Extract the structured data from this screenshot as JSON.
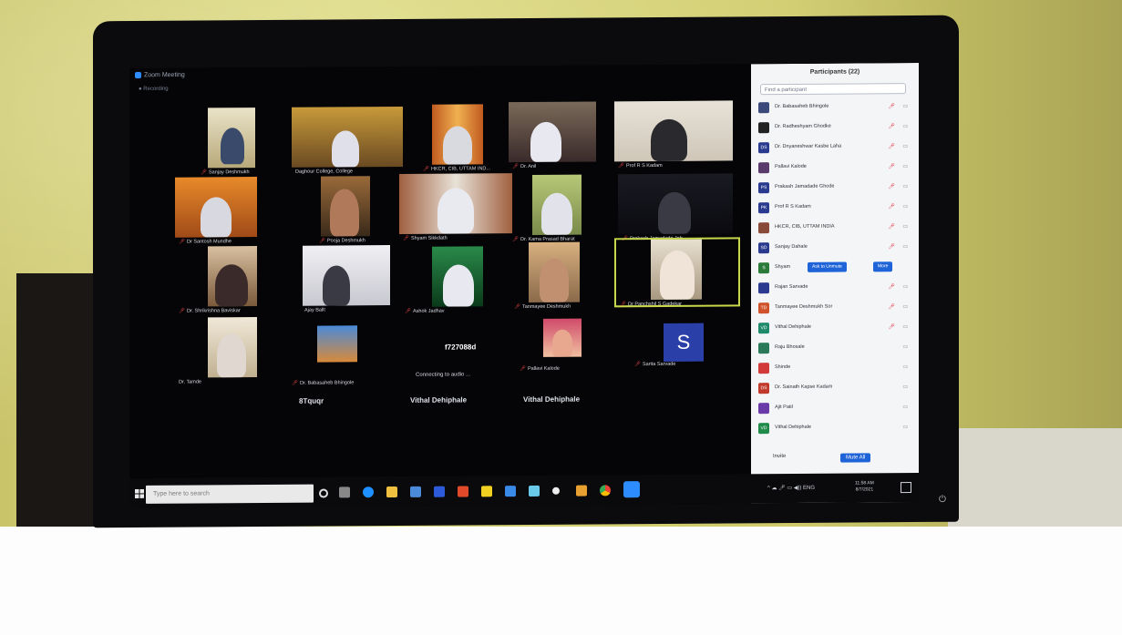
{
  "window": {
    "title": "Zoom Meeting",
    "subtitle": "Recording"
  },
  "gallery": {
    "tiles": [
      {
        "name": "Sanjay Deshmukh",
        "muted": true
      },
      {
        "name": "Daghour College, College",
        "muted": false
      },
      {
        "name": "HKCR, CIB, UTTAM IND...",
        "muted": true
      },
      {
        "name": "Dr. Anil",
        "muted": true
      },
      {
        "name": "Prof R S Kadam",
        "muted": true
      },
      {
        "name": "Dr Santosh Mundhe",
        "muted": true
      },
      {
        "name": "Pooja Deshmukh",
        "muted": true
      },
      {
        "name": "Shyam Sikkdath",
        "muted": true
      },
      {
        "name": "Dr. Kama Prasad Bharat",
        "muted": true
      },
      {
        "name": "Prakash Jamadade Joh",
        "muted": true
      },
      {
        "name": "Dr. Shrikrishna Baviskar",
        "muted": true
      },
      {
        "name": "Ajay Ballt",
        "muted": false
      },
      {
        "name": "Ashok Jadhav",
        "muted": true
      },
      {
        "name": "Tanmayee Deshmukh",
        "muted": true
      },
      {
        "name": "Dr Panchshil S Gadekar",
        "muted": true
      },
      {
        "name": "Dr. Tamde",
        "muted": false
      },
      {
        "name": "Dr. Babasaheb Bhingole",
        "muted": true
      },
      {
        "name": "Connecting to audio ...",
        "meeting_id": "f727088d",
        "muted": false
      },
      {
        "name": "Pallavi Kalode",
        "muted": true
      },
      {
        "name": "Sarita Sarvade",
        "avatar_letter": "S",
        "muted": true
      }
    ],
    "name_only": [
      "8Tquqr",
      "Vithal Dehiphale",
      "Vithal Dehiphale"
    ]
  },
  "participants": {
    "title": "Participants (22)",
    "search_placeholder": "Find a participant",
    "list": [
      {
        "initials": "",
        "name": "Dr. Babasaheb Bhingole",
        "color": "#3b4a7a"
      },
      {
        "initials": "",
        "name": "Dr. Radheshyam Ghodke",
        "color": "#222222"
      },
      {
        "initials": "DS",
        "name": "Dr. Dnyaneshwar Kasbe Laha",
        "color": "#2a3b8f"
      },
      {
        "initials": "",
        "name": "Pallavi Kalode",
        "color": "#5a3a6a"
      },
      {
        "initials": "PS",
        "name": "Prakash Jamadade Ghode",
        "color": "#2a3b8f"
      },
      {
        "initials": "PK",
        "name": "Prof R S Kadam",
        "color": "#2a3b8f"
      },
      {
        "initials": "",
        "name": "HKCR, CIB, UTTAM INDIA",
        "color": "#8a4a3a"
      },
      {
        "initials": "SD",
        "name": "Sanjay Dahale",
        "color": "#2a3b8f"
      },
      {
        "initials": "S",
        "name": "Shyam",
        "color": "#2a7a3a"
      },
      {
        "initials": "",
        "name": "Rajan Sarvade",
        "color": "#2a3b8f"
      },
      {
        "initials": "TD",
        "name": "Tanmayee Deshmukh Sor",
        "color": "#d0522a"
      },
      {
        "initials": "VD",
        "name": "Vithal Dehiphale",
        "color": "#1f8a6a"
      },
      {
        "initials": "",
        "name": "Raju Bhosale",
        "color": "#2a7a5a"
      },
      {
        "initials": "",
        "name": "Shinde",
        "color": "#d23a3a"
      },
      {
        "initials": "DS",
        "name": "Dr. Sainath Kapse Kadam",
        "color": "#c0392b"
      },
      {
        "initials": "",
        "name": "Ajit Patil",
        "color": "#6a3ba8"
      },
      {
        "initials": "VD",
        "name": "Vithal Dehiphale",
        "color": "#1f8a4a"
      }
    ],
    "ask_to_unmute": "Ask to Unmute",
    "more": "More",
    "invite": "Invite",
    "mute_all": "Mute All"
  },
  "taskbar": {
    "search_placeholder": "Type here to search",
    "clock_time": "11:58 AM",
    "clock_date": "8/7/2021",
    "lang": "ENG"
  }
}
